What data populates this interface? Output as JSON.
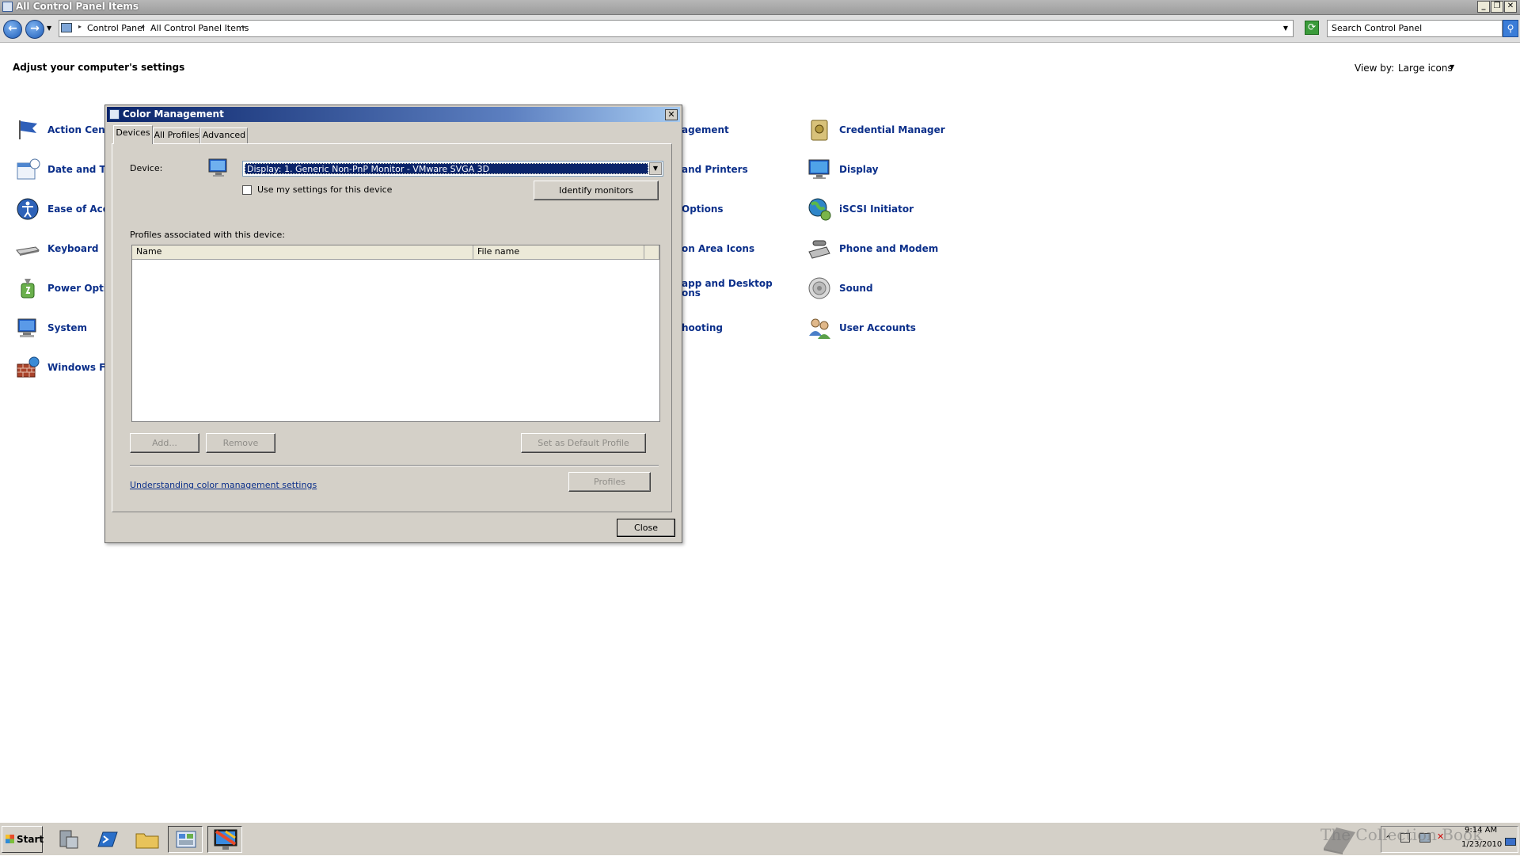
{
  "window": {
    "title": "All Control Panel Items"
  },
  "address": {
    "crumbs": [
      "Control Panel",
      "All Control Panel Items"
    ],
    "search_placeholder": "Search Control Panel"
  },
  "content": {
    "heading": "Adjust your computer's settings",
    "view_by_label": "View by:",
    "view_by_value": "Large icons",
    "items_left": [
      {
        "label": "Action Cente",
        "icon": "flag-icon"
      },
      {
        "label": "Date and Tin",
        "icon": "calendar-icon"
      },
      {
        "label": "Ease of Acce",
        "icon": "accessibility-icon"
      },
      {
        "label": "Keyboard",
        "icon": "keyboard-icon"
      },
      {
        "label": "Power Option",
        "icon": "power-icon"
      },
      {
        "label": "System",
        "icon": "computer-icon"
      },
      {
        "label": "Windows Fire",
        "icon": "firewall-icon"
      }
    ],
    "items_middle": [
      {
        "label": "agement"
      },
      {
        "label": "and Printers"
      },
      {
        "label": "Options"
      },
      {
        "label": "on Area Icons"
      },
      {
        "label_line1": "app and Desktop",
        "label_line2": "ons"
      },
      {
        "label": "hooting"
      }
    ],
    "items_right": [
      {
        "label": "Credential Manager",
        "icon": "vault-icon"
      },
      {
        "label": "Display",
        "icon": "monitor-icon"
      },
      {
        "label": "iSCSI Initiator",
        "icon": "globe-icon"
      },
      {
        "label": "Phone and Modem",
        "icon": "phone-icon"
      },
      {
        "label": "Sound",
        "icon": "speaker-icon"
      },
      {
        "label": "User Accounts",
        "icon": "users-icon"
      }
    ]
  },
  "dialog": {
    "title": "Color Management",
    "tabs": [
      "Devices",
      "All Profiles",
      "Advanced"
    ],
    "device_label": "Device:",
    "device_value": "Display: 1. Generic Non-PnP Monitor - VMware SVGA 3D",
    "use_settings_label": "Use my settings for this device",
    "identify_label": "Identify monitors",
    "profiles_label": "Profiles associated with this device:",
    "columns": [
      "Name",
      "File name"
    ],
    "add_label": "Add...",
    "remove_label": "Remove",
    "default_label": "Set as Default Profile",
    "profiles_button": "Profiles",
    "help_link": "Understanding color management settings",
    "close_label": "Close"
  },
  "taskbar": {
    "start_label": "Start",
    "watermark": "The Collection Book",
    "time": "9:14 AM",
    "date": "1/23/2010"
  },
  "colors": {
    "link": "#0b2f8a",
    "titlebar_active": "#0a246a"
  }
}
